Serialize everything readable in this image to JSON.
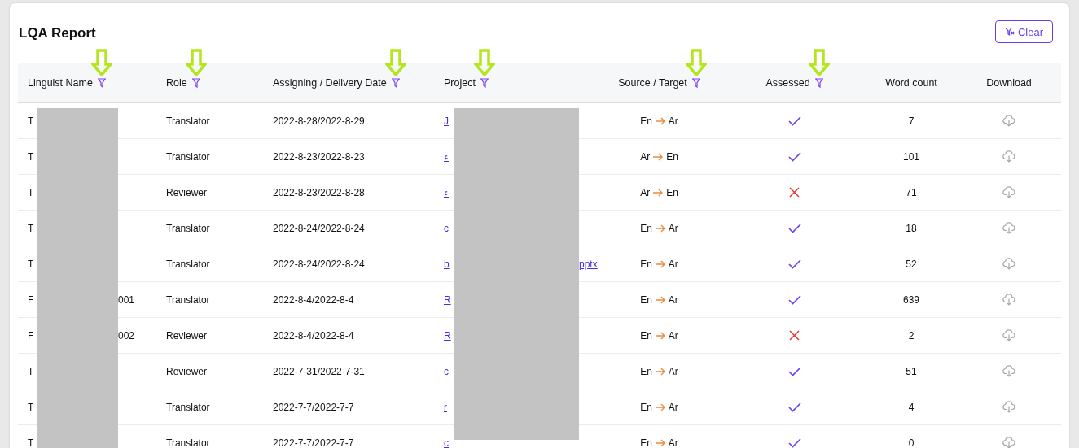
{
  "title": "LQA Report",
  "clear_button": {
    "label": "Clear"
  },
  "columns": [
    {
      "label": "Linguist Name",
      "filter": true
    },
    {
      "label": "Role",
      "filter": true
    },
    {
      "label": "Assigning / Delivery Date",
      "filter": true
    },
    {
      "label": "Project",
      "filter": true
    },
    {
      "label": "Source / Target",
      "filter": true
    },
    {
      "label": "Assessed",
      "filter": true
    },
    {
      "label": "Word count",
      "filter": false
    },
    {
      "label": "Download",
      "filter": false
    }
  ],
  "rows": [
    {
      "name_start": "T",
      "role": "Translator",
      "dates": "2022-8-28/2022-8-29",
      "project_start": "J",
      "source": "En",
      "target": "Ar",
      "assessed": true,
      "word_count": "7"
    },
    {
      "name_start": "T",
      "role": "Translator",
      "dates": "2022-8-23/2022-8-23",
      "project_start": "ء",
      "source": "Ar",
      "target": "En",
      "assessed": true,
      "word_count": "101"
    },
    {
      "name_start": "T",
      "role": "Reviewer",
      "dates": "2022-8-23/2022-8-28",
      "project_start": "ء",
      "source": "Ar",
      "target": "En",
      "assessed": false,
      "word_count": "71"
    },
    {
      "name_start": "T",
      "role": "Translator",
      "dates": "2022-8-24/2022-8-24",
      "project_start": "c",
      "source": "En",
      "target": "Ar",
      "assessed": true,
      "word_count": "18"
    },
    {
      "name_start": "T",
      "role": "Translator",
      "dates": "2022-8-24/2022-8-24",
      "project_start": "b",
      "project_end": "pptx",
      "source": "En",
      "target": "Ar",
      "assessed": true,
      "word_count": "52"
    },
    {
      "name_start": "F",
      "name_end": "001",
      "role": "Translator",
      "dates": "2022-8-4/2022-8-4",
      "project_start": "R",
      "source": "En",
      "target": "Ar",
      "assessed": true,
      "word_count": "639"
    },
    {
      "name_start": "F",
      "name_end": "002",
      "role": "Reviewer",
      "dates": "2022-8-4/2022-8-4",
      "project_start": "R",
      "source": "En",
      "target": "Ar",
      "assessed": false,
      "word_count": "2"
    },
    {
      "name_start": "T",
      "role": "Reviewer",
      "dates": "2022-7-31/2022-7-31",
      "project_start": "c",
      "source": "En",
      "target": "Ar",
      "assessed": true,
      "word_count": "51"
    },
    {
      "name_start": "T",
      "role": "Translator",
      "dates": "2022-7-7/2022-7-7",
      "project_start": "r",
      "source": "En",
      "target": "Ar",
      "assessed": true,
      "word_count": "4"
    },
    {
      "name_start": "T",
      "role": "Translator",
      "dates": "2022-7-7/2022-7-7",
      "project_start": "c",
      "source": "En",
      "target": "Ar",
      "assessed": true,
      "word_count": "0"
    }
  ]
}
